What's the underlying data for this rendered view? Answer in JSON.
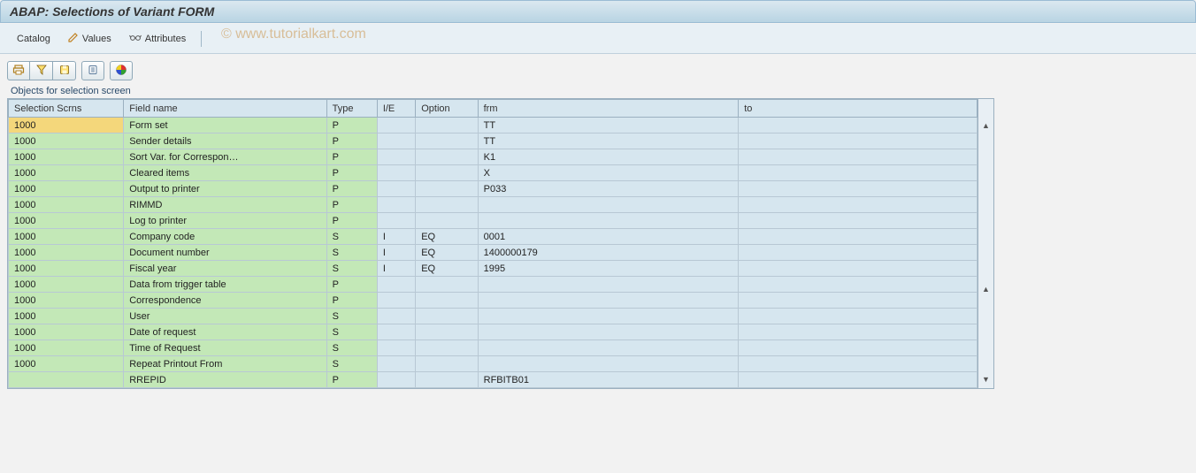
{
  "title": "ABAP: Selections of Variant FORM",
  "toolbar": {
    "catalog": "Catalog",
    "values": "Values",
    "attributes": "Attributes"
  },
  "watermark": "© www.tutorialkart.com",
  "section_title": "Objects for selection screen",
  "columns": {
    "scrns": "Selection Scrns",
    "fname": "Field name",
    "type": "Type",
    "ie": "I/E",
    "option": "Option",
    "frm": "frm",
    "to": "to"
  },
  "rows": [
    {
      "scrns": "1000",
      "highlight": true,
      "fname": "Form set",
      "type": "P",
      "ie": "",
      "option": "",
      "frm": "TT",
      "to": ""
    },
    {
      "scrns": "1000",
      "fname": "Sender details",
      "type": "P",
      "ie": "",
      "option": "",
      "frm": "TT",
      "to": ""
    },
    {
      "scrns": "1000",
      "fname": "Sort Var. for Correspon…",
      "type": "P",
      "ie": "",
      "option": "",
      "frm": "K1",
      "to": ""
    },
    {
      "scrns": "1000",
      "fname": "Cleared items",
      "type": "P",
      "ie": "",
      "option": "",
      "frm": "X",
      "to": ""
    },
    {
      "scrns": "1000",
      "fname": "Output to printer",
      "type": "P",
      "ie": "",
      "option": "",
      "frm": "P033",
      "to": ""
    },
    {
      "scrns": "1000",
      "fname": "RIMMD",
      "type": "P",
      "ie": "",
      "option": "",
      "frm": "",
      "to": ""
    },
    {
      "scrns": "1000",
      "fname": "Log to printer",
      "type": "P",
      "ie": "",
      "option": "",
      "frm": "",
      "to": ""
    },
    {
      "scrns": "1000",
      "fname": "Company code",
      "type": "S",
      "ie": "I",
      "option": "EQ",
      "frm": "0001",
      "to": ""
    },
    {
      "scrns": "1000",
      "fname": "Document number",
      "type": "S",
      "ie": "I",
      "option": "EQ",
      "frm": "1400000179",
      "to": ""
    },
    {
      "scrns": "1000",
      "fname": "Fiscal year",
      "type": "S",
      "ie": "I",
      "option": "EQ",
      "frm": "1995",
      "to": ""
    },
    {
      "scrns": "1000",
      "fname": "Data from trigger table",
      "type": "P",
      "ie": "",
      "option": "",
      "frm": "",
      "to": ""
    },
    {
      "scrns": "1000",
      "fname": "Correspondence",
      "type": "P",
      "ie": "",
      "option": "",
      "frm": "",
      "to": ""
    },
    {
      "scrns": "1000",
      "fname": "User",
      "type": "S",
      "ie": "",
      "option": "",
      "frm": "",
      "to": ""
    },
    {
      "scrns": "1000",
      "fname": "Date of request",
      "type": "S",
      "ie": "",
      "option": "",
      "frm": "",
      "to": ""
    },
    {
      "scrns": "1000",
      "fname": "Time of Request",
      "type": "S",
      "ie": "",
      "option": "",
      "frm": "",
      "to": ""
    },
    {
      "scrns": "1000",
      "fname": "Repeat Printout From",
      "type": "S",
      "ie": "",
      "option": "",
      "frm": "",
      "to": ""
    },
    {
      "scrns": "",
      "fname": "RREPID",
      "type": "P",
      "ie": "",
      "option": "",
      "frm": "RFBITB01",
      "to": ""
    }
  ]
}
